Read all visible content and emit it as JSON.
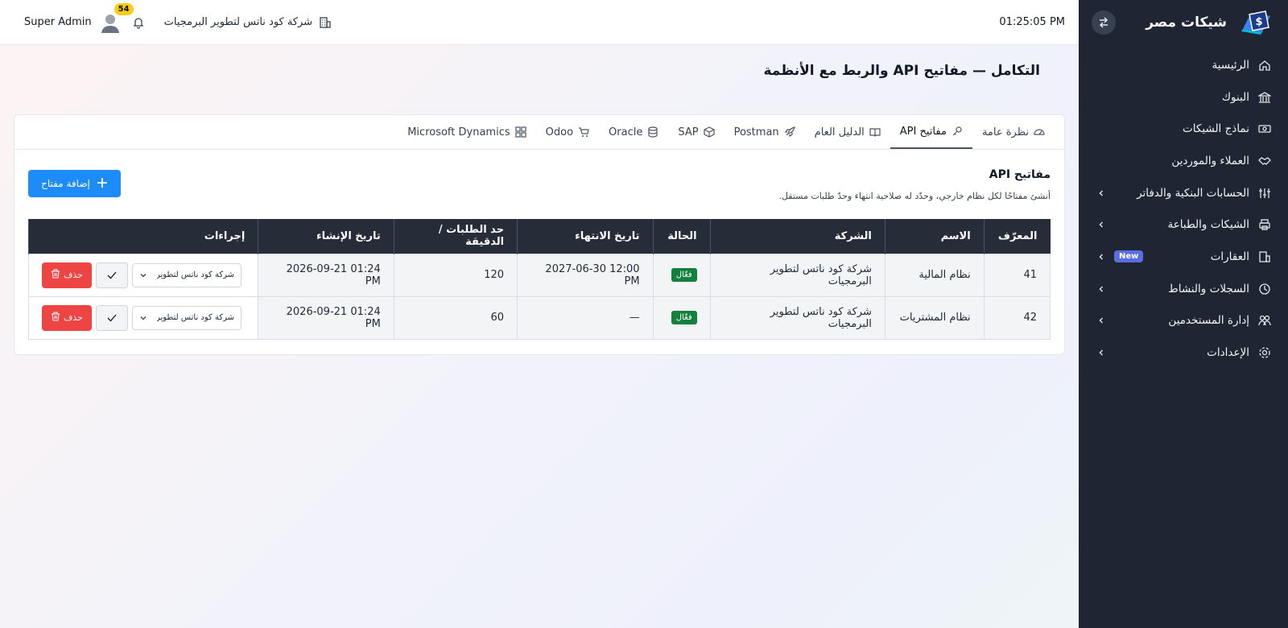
{
  "brand": {
    "name": "شيكات مصر"
  },
  "sidebar": {
    "items": [
      {
        "label": "الرئيسية",
        "icon": "home-icon",
        "chevron": false
      },
      {
        "label": "البنوك",
        "icon": "bank-icon",
        "chevron": false
      },
      {
        "label": "نماذج الشيكات",
        "icon": "cheque-icon",
        "chevron": false
      },
      {
        "label": "العملاء والموردين",
        "icon": "handshake-icon",
        "chevron": false
      },
      {
        "label": "الحسابات البنكية والدفاتر",
        "icon": "sliders-icon",
        "chevron": true
      },
      {
        "label": "الشيكات والطباعة",
        "icon": "printer-icon",
        "chevron": true
      },
      {
        "label": "العقارات",
        "icon": "building-icon",
        "chevron": true,
        "badge": "New"
      },
      {
        "label": "السجلات والنشاط",
        "icon": "history-icon",
        "chevron": true
      },
      {
        "label": "إدارة المستخدمين",
        "icon": "users-icon",
        "chevron": true
      },
      {
        "label": "الإعدادات",
        "icon": "gear-icon",
        "chevron": true
      }
    ]
  },
  "topbar": {
    "clock": "01:25:05 PM",
    "company": "شركة كود ناتس لتطوير البرمجيات",
    "notifications": "54",
    "user": "Super Admin"
  },
  "page": {
    "title": "التكامل — مفاتيح API والربط مع الأنظمة"
  },
  "tabs": [
    {
      "label": "نظرة عامة",
      "icon": "gauge-icon"
    },
    {
      "label": "مفاتيح API",
      "icon": "key-icon"
    },
    {
      "label": "الدليل العام",
      "icon": "book-icon"
    },
    {
      "label": "Postman",
      "icon": "rocket-icon"
    },
    {
      "label": "SAP",
      "icon": "cube-icon"
    },
    {
      "label": "Oracle",
      "icon": "database-icon"
    },
    {
      "label": "Odoo",
      "icon": "cart-icon"
    },
    {
      "label": "Microsoft Dynamics",
      "icon": "grid-icon"
    }
  ],
  "section": {
    "title": "مفاتيح API",
    "subtitle": "أنشئ مفتاحًا لكل نظام خارجي، وحدّد له صلاحية انتهاء وحدّ طلبات مستقل.",
    "add_label": "إضافة مفتاح"
  },
  "table": {
    "headers": [
      "المعرّف",
      "الاسم",
      "الشركة",
      "الحالة",
      "تاريخ الانتهاء",
      "حد الطلبات / الدقيقة",
      "تاريخ الإنشاء",
      "إجراءات"
    ],
    "rows": [
      {
        "id": "41",
        "name": "نظام المالية",
        "company": "شركة كود ناتس لتطوير البرمجيات",
        "status": "فعّال",
        "expiry": "2027-06-30 12:00 PM",
        "limit": "120",
        "created": "2026-09-21 01:24 PM",
        "select": "شركة كود ناتس لتطوير البرمجيات",
        "delete_label": "حذف"
      },
      {
        "id": "42",
        "name": "نظام المشتريات",
        "company": "شركة كود ناتس لتطوير البرمجيات",
        "status": "فعّال",
        "expiry": "—",
        "limit": "60",
        "created": "2026-09-21 01:24 PM",
        "select": "شركة كود ناتس لتطوير البرمجيات",
        "delete_label": "حذف"
      }
    ]
  },
  "colors": {
    "sidebar": "#1f2532",
    "accent": "#1d8cf8",
    "danger": "#ef4444",
    "success": "#15803d",
    "table_head": "#262c38"
  }
}
